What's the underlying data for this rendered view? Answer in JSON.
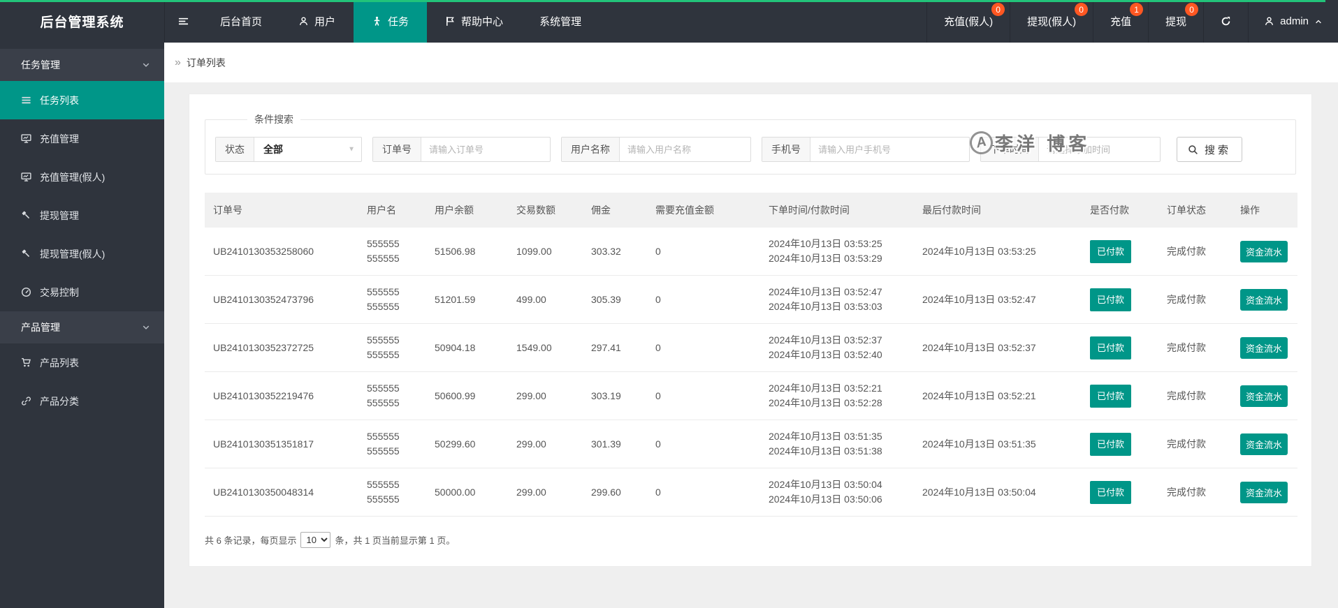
{
  "colors": {
    "accent": "#009688",
    "top_line": "#22c37a",
    "badge": "#ff5722",
    "dark": "#2f343d"
  },
  "app_title": "后台管理系统",
  "navbar": {
    "menu": [
      {
        "label": "后台首页",
        "icon": "",
        "active": false
      },
      {
        "label": "用户",
        "icon": "user-icon",
        "active": false
      },
      {
        "label": "任务",
        "icon": "walking-person-icon",
        "active": true
      },
      {
        "label": "帮助中心",
        "icon": "flag-icon",
        "active": false
      },
      {
        "label": "系统管理",
        "icon": "",
        "active": false
      }
    ],
    "quick_links": [
      {
        "label": "充值(假人)",
        "badge": "0"
      },
      {
        "label": "提现(假人)",
        "badge": "0"
      },
      {
        "label": "充值",
        "badge": "1"
      },
      {
        "label": "提现",
        "badge": "0"
      }
    ],
    "user": {
      "name": "admin"
    }
  },
  "sidebar": {
    "sections": [
      {
        "label": "任务管理",
        "items": [
          {
            "label": "任务列表",
            "icon": "list-icon",
            "active": true
          },
          {
            "label": "充值管理",
            "icon": "board-chart-icon",
            "active": false
          },
          {
            "label": "充值管理(假人)",
            "icon": "board-chart-icon",
            "active": false
          },
          {
            "label": "提现管理",
            "icon": "gavel-icon",
            "active": false
          },
          {
            "label": "提现管理(假人)",
            "icon": "gavel-icon",
            "active": false
          },
          {
            "label": "交易控制",
            "icon": "gauge-icon",
            "active": false
          }
        ]
      },
      {
        "label": "产品管理",
        "items": [
          {
            "label": "产品列表",
            "icon": "cart-icon",
            "active": false
          },
          {
            "label": "产品分类",
            "icon": "link-icon",
            "active": false
          }
        ]
      }
    ]
  },
  "breadcrumb": {
    "title": "订单列表"
  },
  "filter": {
    "legend": "条件搜索",
    "fields": [
      {
        "label": "状态",
        "type": "select",
        "value": "全部"
      },
      {
        "label": "订单号",
        "type": "text",
        "placeholder": "请输入订单号"
      },
      {
        "label": "用户名称",
        "type": "text",
        "placeholder": "请输入用户名称"
      },
      {
        "label": "手机号",
        "type": "text",
        "placeholder": "请输入用户手机号"
      },
      {
        "label": "下单时间",
        "type": "text",
        "placeholder": "请选择添加时间"
      }
    ],
    "search_label": "搜索"
  },
  "watermark": {
    "logo_letter": "A",
    "text": "李洋 博客"
  },
  "table": {
    "columns": [
      "订单号",
      "用户名",
      "用户余额",
      "交易数额",
      "佣金",
      "需要充值金额",
      "下单时间/付款时间",
      "最后付款时间",
      "是否付款",
      "订单状态",
      "操作"
    ],
    "rows": [
      {
        "order_no": "UB2410130353258060",
        "username_lines": [
          "555555",
          "555555"
        ],
        "balance": "51506.98",
        "trade_amount": "1099.00",
        "commission": "303.32",
        "need_recharge": "0",
        "order_time": "2024年10月13日 03:53:25",
        "pay_time": "2024年10月13日 03:53:29",
        "last_pay_time": "2024年10月13日 03:53:25",
        "paid_label": "已付款",
        "status": "完成付款",
        "action_label": "资金流水"
      },
      {
        "order_no": "UB2410130352473796",
        "username_lines": [
          "555555",
          "555555"
        ],
        "balance": "51201.59",
        "trade_amount": "499.00",
        "commission": "305.39",
        "need_recharge": "0",
        "order_time": "2024年10月13日 03:52:47",
        "pay_time": "2024年10月13日 03:53:03",
        "last_pay_time": "2024年10月13日 03:52:47",
        "paid_label": "已付款",
        "status": "完成付款",
        "action_label": "资金流水"
      },
      {
        "order_no": "UB2410130352372725",
        "username_lines": [
          "555555",
          "555555"
        ],
        "balance": "50904.18",
        "trade_amount": "1549.00",
        "commission": "297.41",
        "need_recharge": "0",
        "order_time": "2024年10月13日 03:52:37",
        "pay_time": "2024年10月13日 03:52:40",
        "last_pay_time": "2024年10月13日 03:52:37",
        "paid_label": "已付款",
        "status": "完成付款",
        "action_label": "资金流水"
      },
      {
        "order_no": "UB2410130352219476",
        "username_lines": [
          "555555",
          "555555"
        ],
        "balance": "50600.99",
        "trade_amount": "299.00",
        "commission": "303.19",
        "need_recharge": "0",
        "order_time": "2024年10月13日 03:52:21",
        "pay_time": "2024年10月13日 03:52:28",
        "last_pay_time": "2024年10月13日 03:52:21",
        "paid_label": "已付款",
        "status": "完成付款",
        "action_label": "资金流水"
      },
      {
        "order_no": "UB2410130351351817",
        "username_lines": [
          "555555",
          "555555"
        ],
        "balance": "50299.60",
        "trade_amount": "299.00",
        "commission": "301.39",
        "need_recharge": "0",
        "order_time": "2024年10月13日 03:51:35",
        "pay_time": "2024年10月13日 03:51:38",
        "last_pay_time": "2024年10月13日 03:51:35",
        "paid_label": "已付款",
        "status": "完成付款",
        "action_label": "资金流水"
      },
      {
        "order_no": "UB2410130350048314",
        "username_lines": [
          "555555",
          "555555"
        ],
        "balance": "50000.00",
        "trade_amount": "299.00",
        "commission": "299.60",
        "need_recharge": "0",
        "order_time": "2024年10月13日 03:50:04",
        "pay_time": "2024年10月13日 03:50:06",
        "last_pay_time": "2024年10月13日 03:50:04",
        "paid_label": "已付款",
        "status": "完成付款",
        "action_label": "资金流水"
      }
    ]
  },
  "pagination": {
    "prefix": "共 6 条记录，每页显示",
    "page_size": "10",
    "suffix": "条，共 1 页当前显示第 1 页。"
  }
}
